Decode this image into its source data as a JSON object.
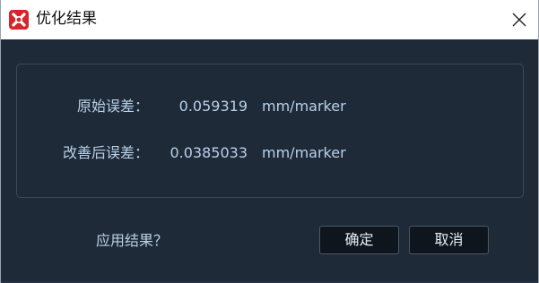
{
  "window": {
    "title": "优化结果"
  },
  "results": {
    "original_error_label": "原始误差：",
    "original_error_value": "0.059319",
    "original_error_unit": "mm/marker",
    "improved_error_label": "改善后误差：",
    "improved_error_value": "0.0385033",
    "improved_error_unit": "mm/marker"
  },
  "footer": {
    "question": "应用结果？",
    "ok_label": "确定",
    "cancel_label": "取消"
  },
  "icons": {
    "app": "app-logo-icon",
    "close": "close-icon"
  },
  "colors": {
    "background": "#1f2a38",
    "text": "#b9d0ea",
    "button_bg": "#0f151d",
    "logo_red": "#d7262b"
  }
}
